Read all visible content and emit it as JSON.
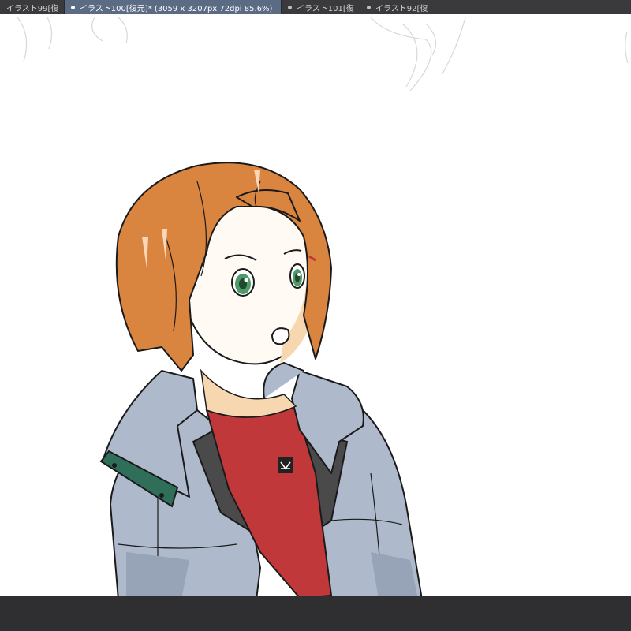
{
  "tabs": [
    {
      "label": "イラスト99[復",
      "active": false,
      "dot": false
    },
    {
      "label": "イラスト100[復元]* (3059 x 3207px 72dpi 85.6%)",
      "active": true,
      "dot": true
    },
    {
      "label": "イラスト101[復",
      "active": false,
      "dot": true
    },
    {
      "label": "イラスト92[復",
      "active": false,
      "dot": true
    }
  ],
  "colors": {
    "tabbar_bg": "#3a3a3c",
    "active_tab_bg": "#5b6b84",
    "bottombar_bg": "#2f2f31",
    "hair": "#d9843f",
    "skin": "#f6d7b0",
    "eyes": "#4f9a66",
    "jacket": "#aeb9cb",
    "jacket_shadow": "#9aa6ba",
    "shirt": "#c0383a",
    "lining": "#4a4a4a",
    "strap": "#2f6e58"
  }
}
